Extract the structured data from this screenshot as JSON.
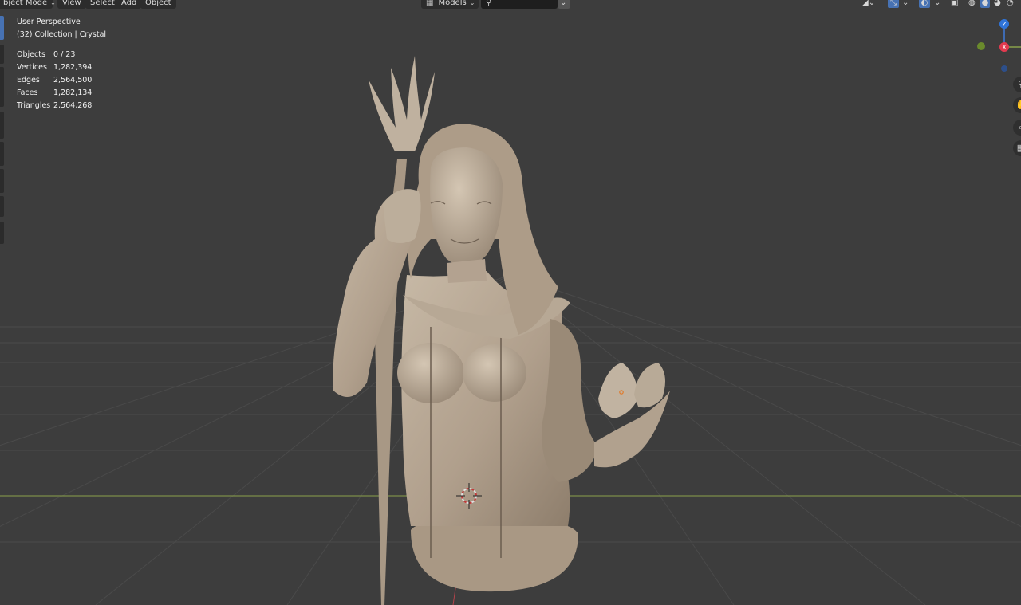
{
  "header": {
    "mode_label": "bject Mode",
    "menu": [
      "View",
      "Select",
      "Add",
      "Object"
    ],
    "collection_filter_label": "Models",
    "search_placeholder": ""
  },
  "overlay": {
    "perspective": "User Perspective",
    "collection": "(32) Collection | Crystal",
    "stats": [
      {
        "label": "Objects",
        "value": "0 / 23"
      },
      {
        "label": "Vertices",
        "value": "1,282,394"
      },
      {
        "label": "Edges",
        "value": "2,564,500"
      },
      {
        "label": "Faces",
        "value": "1,282,134"
      },
      {
        "label": "Triangles",
        "value": "2,564,268"
      }
    ]
  },
  "gizmo": {
    "z_label": "Z",
    "x_label": "X"
  },
  "colors": {
    "viewport_bg": "#3d3d3d",
    "grid": "#4a4a4a",
    "x_axis": "#8aa14b",
    "y_axis": "#b5434b",
    "model": "#b8aa99",
    "active_tool": "#4772b3"
  },
  "icons": [
    "chevron-down-icon",
    "search-icon",
    "cursor-icon",
    "snap-icon",
    "overlay-icon",
    "xray-icon",
    "wireframe-shading-icon",
    "solid-shading-icon",
    "material-shading-icon",
    "rendered-shading-icon",
    "zoom-icon",
    "hand-pan-icon",
    "camera-icon",
    "grid-icon"
  ]
}
